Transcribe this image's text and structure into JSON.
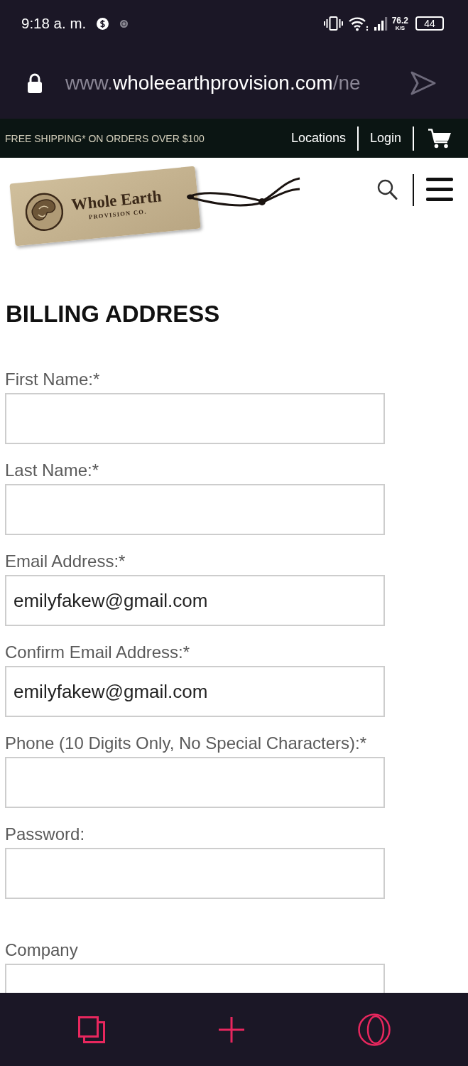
{
  "status_bar": {
    "time": "9:18 a. m.",
    "network_speed": "76.2",
    "speed_unit": "K/S",
    "battery": "44"
  },
  "address_bar": {
    "url_prefix": "www.",
    "url_host": "wholeearthprovision.com",
    "url_path": "/ne"
  },
  "promo_bar": {
    "message": "FREE SHIPPING* ON ORDERS OVER $100",
    "links": [
      "Locations",
      "Login"
    ]
  },
  "logo": {
    "name": "Whole Earth",
    "tagline": "PROVISION CO."
  },
  "page_title": "BILLING ADDRESS",
  "form_sections": [
    {
      "fields": [
        {
          "label": "First Name:*"
        },
        {
          "label": "Last Name:*"
        },
        {
          "label": "Email Address:*",
          "value": "emilyfakew@gmail.com"
        },
        {
          "label": "Confirm Email Address:*",
          "value": "emilyfakew@gmail.com"
        },
        {
          "label": "Phone (10 Digits Only, No Special Characters):*"
        },
        {
          "label": "Password:"
        }
      ]
    },
    {
      "fields": [
        {
          "label": "Company"
        }
      ]
    }
  ]
}
